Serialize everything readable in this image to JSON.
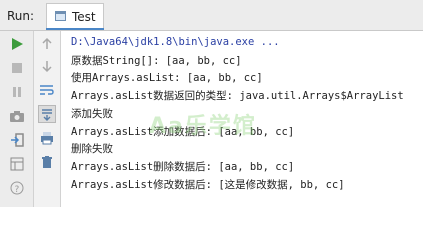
{
  "toolbar": {
    "run_label": "Run:",
    "tab_title": "Test"
  },
  "console": {
    "lines": [
      "D:\\Java64\\jdk1.8\\bin\\java.exe ...",
      "原数据String[]: [aa, bb, cc]",
      "使用Arrays.asList: [aa, bb, cc]",
      "Arrays.asList数据返回的类型: java.util.Arrays$ArrayList",
      "添加失败",
      "Arrays.asList添加数据后: [aa, bb, cc]",
      "删除失败",
      "Arrays.asList删除数据后: [aa, bb, cc]",
      "Arrays.asList修改数据后: [这是修改数据, bb, cc]"
    ],
    "watermark": "Aa乐学馆"
  },
  "colors": {
    "run_green": "#3c9c3c",
    "stop_gray": "#b0b0b0",
    "accent_blue": "#4a86c7"
  }
}
